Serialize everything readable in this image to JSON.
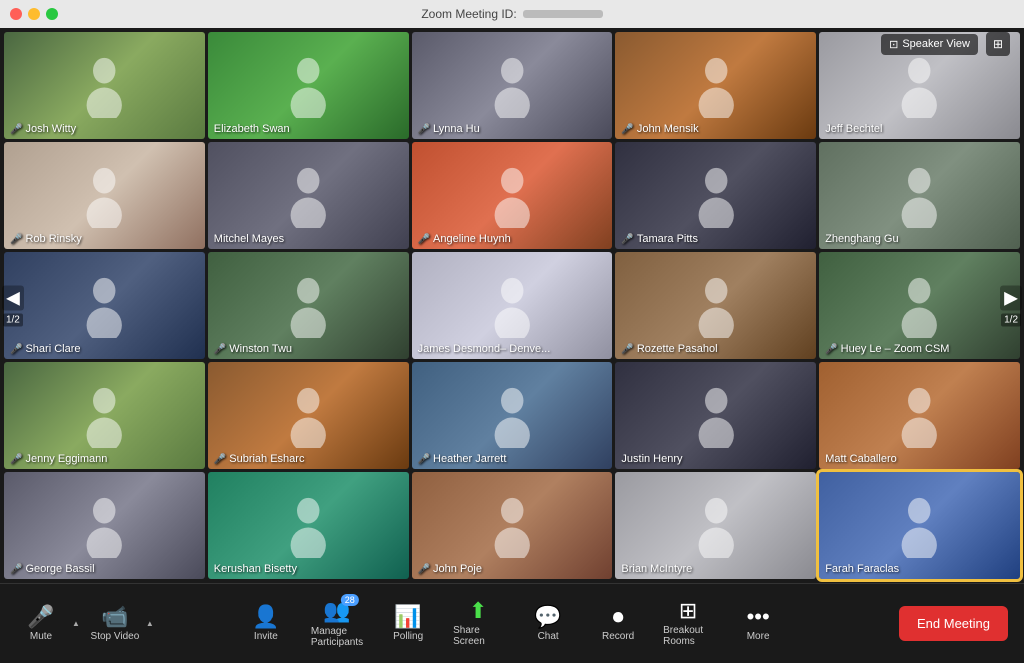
{
  "titlebar": {
    "title": "Zoom Meeting ID:",
    "meeting_id": ""
  },
  "toolbar_top": {
    "speaker_view": "Speaker View",
    "grid_icon": "⊞"
  },
  "participants": [
    {
      "name": "Josh Witty",
      "bg": "bg-office1",
      "muted": true
    },
    {
      "name": "Elizabeth Swan",
      "bg": "bg-green",
      "muted": false
    },
    {
      "name": "Lynna Hu",
      "bg": "bg-office2",
      "muted": true
    },
    {
      "name": "John Mensik",
      "bg": "bg-warm",
      "muted": true
    },
    {
      "name": "Jeff Bechtel",
      "bg": "bg-light",
      "muted": false
    },
    {
      "name": "Rob Rinsky",
      "bg": "bg-baby",
      "muted": true
    },
    {
      "name": "Mitchel Mayes",
      "bg": "bg-office3",
      "muted": false
    },
    {
      "name": "Angeline Huynh",
      "bg": "bg-sunset",
      "muted": true
    },
    {
      "name": "Tamara Pitts",
      "bg": "bg-dark",
      "muted": true
    },
    {
      "name": "Zhenghang Gu",
      "bg": "bg-office4",
      "muted": false
    },
    {
      "name": "Shari Clare",
      "bg": "bg-blue",
      "muted": true
    },
    {
      "name": "Winston Twu",
      "bg": "bg-nature",
      "muted": true
    },
    {
      "name": "James Desmond– Denve...",
      "bg": "bg-bright",
      "muted": false
    },
    {
      "name": "Rozette Pasahol",
      "bg": "bg-indoor",
      "muted": true
    },
    {
      "name": "Huey Le – Zoom CSM",
      "bg": "bg-nature",
      "muted": true
    },
    {
      "name": "Jenny Eggimann",
      "bg": "bg-office1",
      "muted": true
    },
    {
      "name": "Subriah Esharc",
      "bg": "bg-warm",
      "muted": true
    },
    {
      "name": "Heather Jarrett",
      "bg": "bg-outdoor",
      "muted": true
    },
    {
      "name": "Justin Henry",
      "bg": "bg-dark",
      "muted": false
    },
    {
      "name": "Matt Caballero",
      "bg": "bg-autumn",
      "muted": false
    },
    {
      "name": "George Bassil",
      "bg": "bg-office2",
      "muted": true
    },
    {
      "name": "Kerushan Bisetty",
      "bg": "bg-pool",
      "muted": false
    },
    {
      "name": "John Poje",
      "bg": "bg-cafe",
      "muted": true
    },
    {
      "name": "Brian McIntyre",
      "bg": "bg-light",
      "muted": false
    },
    {
      "name": "Farah Faraclas",
      "bg": "bg-mountain",
      "muted": false,
      "highlighted": true
    }
  ],
  "page": {
    "left_arrow": "◀",
    "right_arrow": "▶",
    "current": "1/2"
  },
  "bottom_toolbar": {
    "mute_label": "Mute",
    "stop_video_label": "Stop Video",
    "invite_label": "Invite",
    "manage_participants_label": "Manage Participants",
    "participants_count": "28",
    "polling_label": "Polling",
    "share_screen_label": "Share Screen",
    "chat_label": "Chat",
    "record_label": "Record",
    "breakout_rooms_label": "Breakout Rooms",
    "more_label": "More",
    "end_meeting_label": "End Meeting"
  }
}
